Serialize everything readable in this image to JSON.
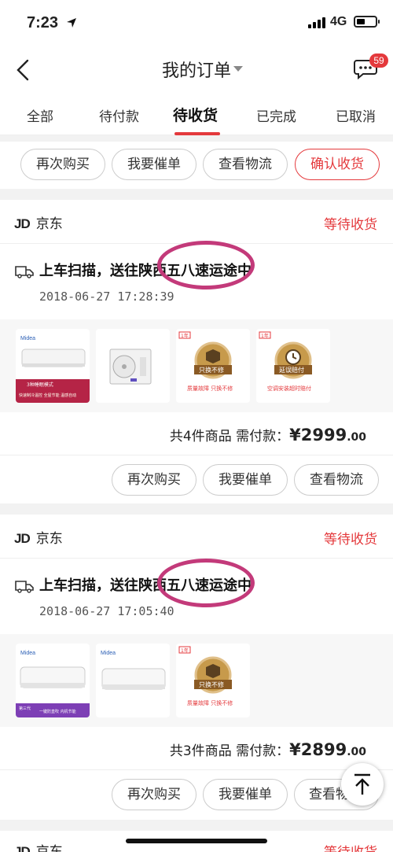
{
  "status_bar": {
    "time": "7:23",
    "network": "4G"
  },
  "nav": {
    "title": "我的订单",
    "message_badge": "59"
  },
  "tabs": [
    "全部",
    "待付款",
    "待收货",
    "已完成",
    "已取消"
  ],
  "active_tab": "待收货",
  "top_actions": [
    "再次购买",
    "我要催单",
    "查看物流",
    "确认收货"
  ],
  "orders": [
    {
      "shop": "京东",
      "shop_logo": "JD",
      "status": "等待收货",
      "logistics": "上车扫描，送往陕西五八速运途中",
      "time": "2018-06-27 17:28:39",
      "products": [
        {
          "icon": "air-conditioner-indoor-unit",
          "caption": "3种睡眠模式  快速制冷温控 · 全屋节能 · 温感自动"
        },
        {
          "icon": "air-conditioner-outdoor-unit",
          "caption": ""
        },
        {
          "icon": "service-badge",
          "badge": "只换不修",
          "caption": "质量故障  只换不修",
          "tag": "①1年"
        },
        {
          "icon": "service-badge",
          "badge": "延误赔付",
          "caption": "空调安装超时赔付",
          "tag": "①1年"
        }
      ],
      "summary_count": "共4件商品",
      "summary_label": "需付款：",
      "price_main": "¥2999",
      "price_decimal": ".00",
      "actions": [
        "再次购买",
        "我要催单",
        "查看物流"
      ]
    },
    {
      "shop": "京东",
      "shop_logo": "JD",
      "status": "等待收货",
      "logistics": "上车扫描，送往陕西五八速运途中",
      "time": "2018-06-27 17:05:40",
      "products": [
        {
          "icon": "air-conditioner-indoor-unit",
          "brand": "Midea",
          "caption": "第三代  一键防直吹  内机节能"
        },
        {
          "icon": "air-conditioner-indoor-unit",
          "brand": "Midea",
          "caption": ""
        },
        {
          "icon": "service-badge",
          "badge": "只换不修",
          "caption": "质量故障  只换不修",
          "tag": "①1年"
        }
      ],
      "summary_count": "共3件商品",
      "summary_label": "需付款：",
      "price_main": "¥2899",
      "price_decimal": ".00",
      "actions": [
        "再次购买",
        "我要催单",
        "查看物"
      ]
    },
    {
      "shop": "京东",
      "shop_logo": "JD",
      "status": "等待收货"
    }
  ],
  "colors": {
    "accent": "#e4393c",
    "annotation": "#c33a7a",
    "background": "#f2f2f2"
  }
}
